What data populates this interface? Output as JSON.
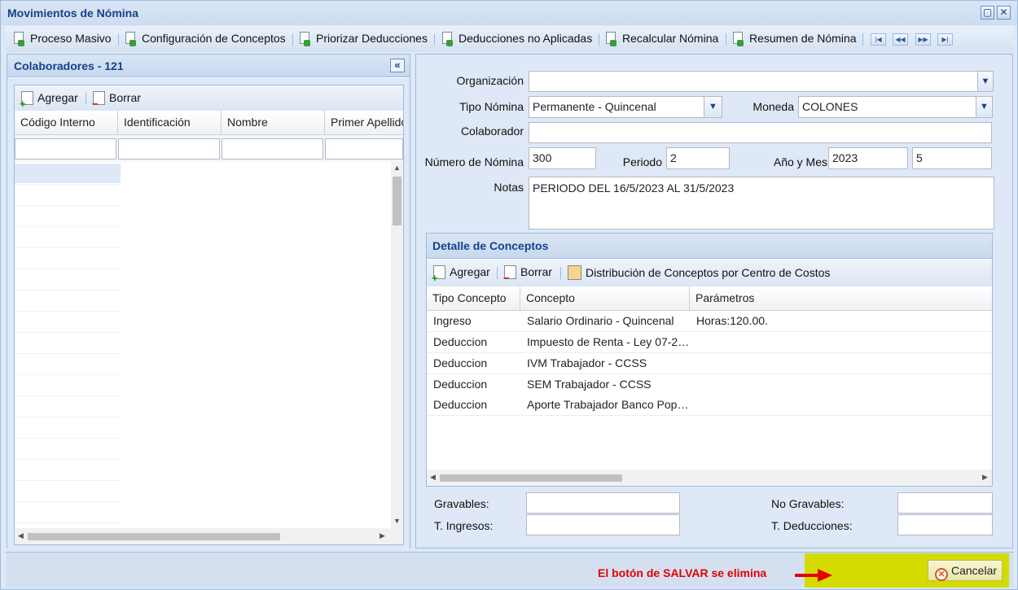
{
  "window": {
    "title": "Movimientos de Nómina"
  },
  "toolbar": {
    "items": [
      "Proceso Masivo",
      "Configuración de Conceptos",
      "Priorizar Deducciones",
      "Deducciones no Aplicadas",
      "Recalcular Nómina",
      "Resumen de Nómina"
    ]
  },
  "left_panel": {
    "title": "Colaboradores - 121",
    "add_label": "Agregar",
    "delete_label": "Borrar",
    "columns": [
      "Código Interno",
      "Identificación",
      "Nombre",
      "Primer Apellido"
    ]
  },
  "form": {
    "organizacion_label": "Organización",
    "organizacion_value": "",
    "tipo_nomina_label": "Tipo Nómina",
    "tipo_nomina_value": "Permanente - Quincenal",
    "moneda_label": "Moneda",
    "moneda_value": "COLONES",
    "colaborador_label": "Colaborador",
    "colaborador_value": "",
    "numero_label": "Número de Nómina",
    "numero_value": "300",
    "periodo_label": "Periodo",
    "periodo_value": "2",
    "anio_mes_label": "Año y Mes",
    "anio_value": "2023",
    "mes_value": "5",
    "notas_label": "Notas",
    "notas_value": "PERIODO DEL 16/5/2023 AL 31/5/2023"
  },
  "detail": {
    "title": "Detalle de Conceptos",
    "add_label": "Agregar",
    "delete_label": "Borrar",
    "distribution_label": "Distribución de Conceptos por Centro de Costos",
    "columns": [
      "Tipo Concepto",
      "Concepto",
      "Parámetros"
    ],
    "rows": [
      {
        "tipo": "Ingreso",
        "concepto": "Salario Ordinario - Quincenal",
        "parametros": "Horas:120.00."
      },
      {
        "tipo": "Deduccion",
        "concepto": "Impuesto de Renta - Ley 07-2…",
        "parametros": ""
      },
      {
        "tipo": "Deduccion",
        "concepto": "IVM Trabajador - CCSS",
        "parametros": ""
      },
      {
        "tipo": "Deduccion",
        "concepto": "SEM Trabajador - CCSS",
        "parametros": ""
      },
      {
        "tipo": "Deduccion",
        "concepto": "Aporte Trabajador Banco Pop…",
        "parametros": ""
      }
    ]
  },
  "totals": {
    "gravables_label": "Gravables:",
    "no_gravables_label": "No Gravables:",
    "t_ingresos_label": "T. Ingresos:",
    "t_deducciones_label": "T. Deducciones:"
  },
  "footer": {
    "note": "El botón de SALVAR se elimina",
    "cancel_label": "Cancelar"
  },
  "colors": {
    "title_blue": "#15428b",
    "panel_bg": "#dfe8f6",
    "highlight": "#d3db00",
    "note_red": "#e30000"
  }
}
